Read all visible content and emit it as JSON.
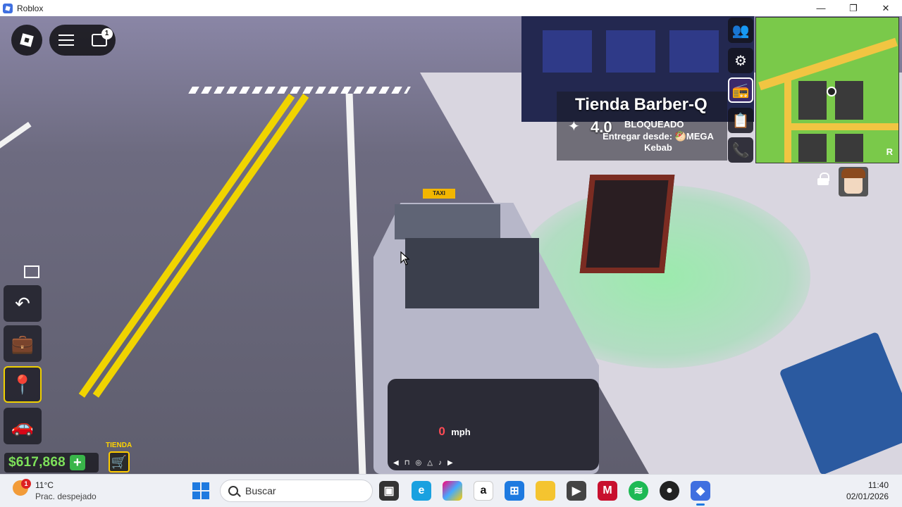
{
  "window": {
    "title": "Roblox",
    "controls": {
      "minimize": "—",
      "maximize": "❐",
      "close": "✕"
    }
  },
  "hud": {
    "chat_badge_count": "1",
    "money": "$617,868",
    "money_add": "+",
    "shop_label": "TIENDA"
  },
  "destination": {
    "name": "Tienda Barber-Q",
    "rating": "4.0",
    "status": "BLOQUEADO",
    "deliver_from": "Entregar desde: 🥙MEGA Kebab"
  },
  "vehicle": {
    "taxi_sign": "TAXI",
    "speed": "0",
    "speed_unit": "mph"
  },
  "right_buttons": [
    {
      "icon": "group-icon"
    },
    {
      "icon": "gear-icon"
    },
    {
      "icon": "radio-icon"
    },
    {
      "icon": "clipboard-icon"
    },
    {
      "icon": "phone-icon"
    }
  ],
  "left_buttons": [
    {
      "icon": "back-arrow-icon"
    },
    {
      "icon": "briefcase-icon"
    },
    {
      "icon": "map-pin-icon"
    },
    {
      "icon": "car-icon"
    }
  ],
  "minimap": {
    "corner_label": "R"
  },
  "taskbar": {
    "weather_temp": "11°C",
    "weather_desc": "Prac. despejado",
    "weather_badge": "1",
    "search_placeholder": "Buscar",
    "time": "11:40",
    "date": "02/01/2026",
    "apps": [
      "task-view",
      "edge",
      "copilot",
      "amazon",
      "store",
      "file-explorer",
      "media-player",
      "mcafee",
      "spotify",
      "obs",
      "roblox"
    ]
  },
  "colors": {
    "money": "#7de05a",
    "shop": "#ffcc00",
    "speed": "#ff4b55",
    "accent": "#1e7ae0"
  }
}
